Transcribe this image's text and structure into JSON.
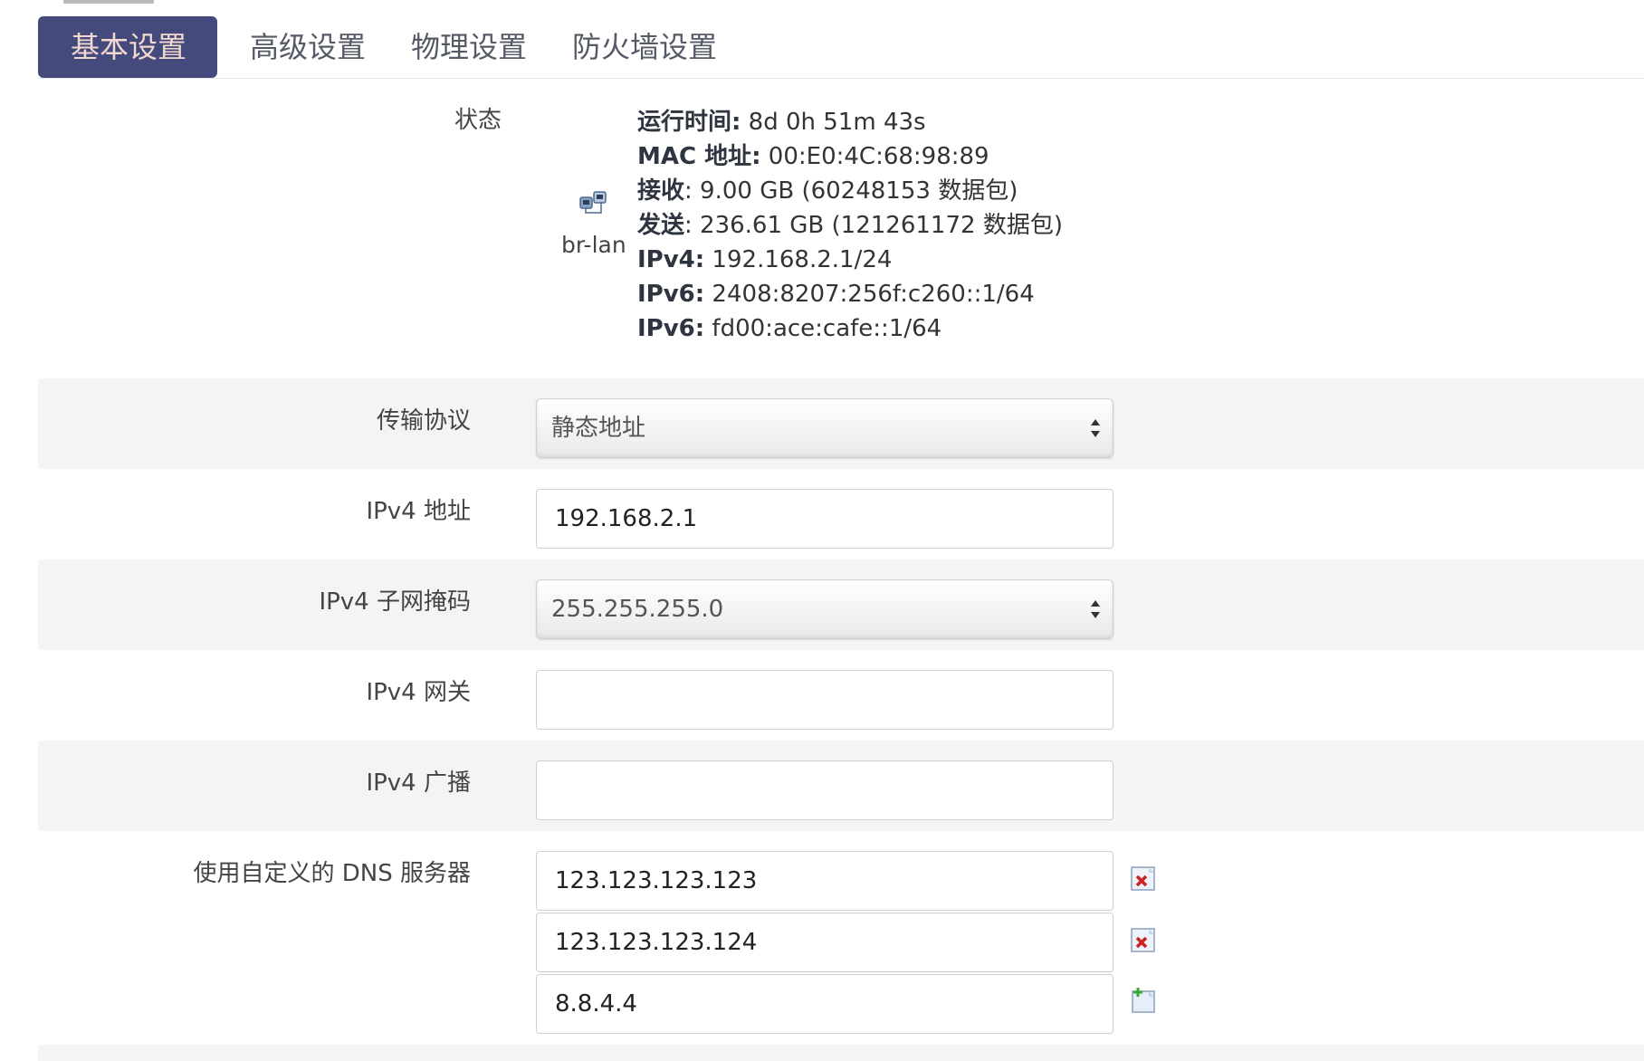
{
  "tabs": [
    {
      "label": "基本设置",
      "active": true
    },
    {
      "label": "高级设置",
      "active": false
    },
    {
      "label": "物理设置",
      "active": false
    },
    {
      "label": "防火墙设置",
      "active": false
    }
  ],
  "status": {
    "label": "状态",
    "interface": "br-lan",
    "icon": "network-interface-icon",
    "lines": [
      {
        "key": "运行时间:",
        "value": " 8d 0h 51m 43s"
      },
      {
        "key": "MAC 地址:",
        "value": " 00:E0:4C:68:98:89"
      },
      {
        "key": "接收",
        "value": ": 9.00 GB (60248153 数据包)"
      },
      {
        "key": "发送",
        "value": ": 236.61 GB (121261172 数据包)"
      },
      {
        "key": "IPv4:",
        "value": " 192.168.2.1/24"
      },
      {
        "key": "IPv6:",
        "value": " 2408:8207:256f:c260::1/64"
      },
      {
        "key": "IPv6:",
        "value": " fd00:ace:cafe::1/64"
      }
    ]
  },
  "form": {
    "protocol": {
      "label": "传输协议",
      "value": "静态地址"
    },
    "ipv4_address": {
      "label": "IPv4 地址",
      "value": "192.168.2.1"
    },
    "ipv4_netmask": {
      "label": "IPv4 子网掩码",
      "value": "255.255.255.0"
    },
    "ipv4_gateway": {
      "label": "IPv4 网关",
      "value": ""
    },
    "ipv4_broadcast": {
      "label": "IPv4 广播",
      "value": ""
    },
    "dns": {
      "label": "使用自定义的 DNS 服务器",
      "entries": [
        "123.123.123.123",
        "123.123.123.124",
        "8.8.4.4"
      ]
    }
  },
  "colors": {
    "tab_active_bg": "#444b7c",
    "tab_active_text": "#f2d8cf",
    "row_shade": "#f4f4f4",
    "remove_icon": "#cc2222",
    "add_icon": "#3aa835"
  }
}
